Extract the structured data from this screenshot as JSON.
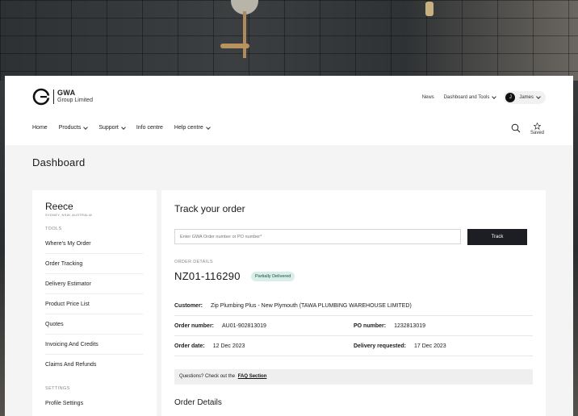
{
  "header": {
    "brand": {
      "line1": "GWA",
      "line2": "Group Limited"
    },
    "util": {
      "news": "News",
      "dashboard_tools": "Dashboard and Tools",
      "user_initial": "J",
      "user_name": "James"
    },
    "nav": {
      "home": "Home",
      "products": "Products",
      "support": "Support",
      "info": "Info centre",
      "help": "Help centre"
    },
    "saved_label": "Saved"
  },
  "page_title": "Dashboard",
  "sidebar": {
    "org_name": "Reece",
    "org_sub": "SYDNEY, NSW, AUSTRALIA",
    "tools_heading": "TOOLS",
    "items": [
      "Where's My Order",
      "Order Tracking",
      "Delivery Estimator",
      "Product Price List",
      "Quotes",
      "Invoicing And Credits",
      "Claims And Refunds"
    ],
    "settings_heading": "SETTINGS",
    "settings_items": [
      "Profile Settings"
    ]
  },
  "track": {
    "title": "Track your order",
    "placeholder": "Enter GWA Order number or PO number*",
    "button": "Track"
  },
  "order": {
    "details_label": "ORDER DETAILS",
    "number": "NZ01-116290",
    "status": "Partially Delivered",
    "customer_label": "Customer:",
    "customer_value": "Zip Plumbing Plus - New Plymouth (TAWA PLUMBING WAREHOUSE LIMITED)",
    "order_number_label": "Order number:",
    "order_number_value": "AU01-902813019",
    "po_label": "PO number:",
    "po_value": "1232813019",
    "order_date_label": "Order date:",
    "order_date_value": "12 Dec 2023",
    "delivery_label": "Delivery requested:",
    "delivery_value": "17 Dec 2023",
    "faq_text": "Questions? Check out the",
    "faq_link": "FAQ Section",
    "details_title": "Order Details"
  }
}
